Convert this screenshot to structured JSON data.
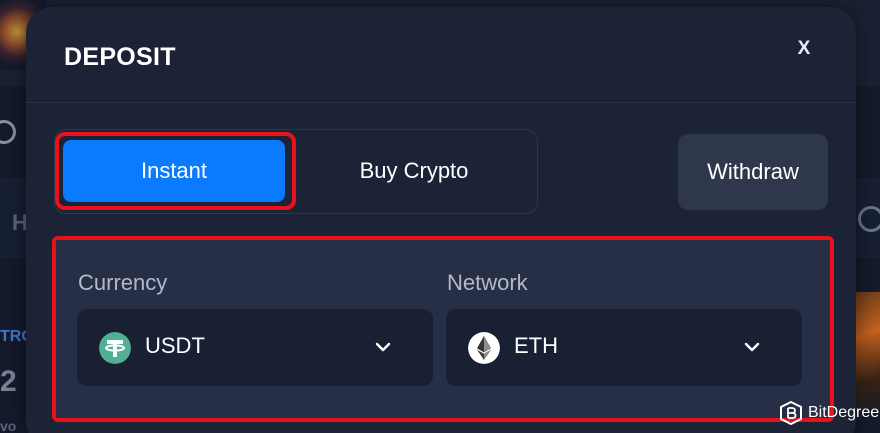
{
  "modal": {
    "title": "DEPOSIT",
    "close_label": "X"
  },
  "tabs": [
    {
      "label": "Instant",
      "active": true
    },
    {
      "label": "Buy Crypto",
      "active": false
    }
  ],
  "withdraw_label": "Withdraw",
  "currency": {
    "label": "Currency",
    "value": "USDT",
    "icon": "tether-icon"
  },
  "network": {
    "label": "Network",
    "value": "ETH",
    "icon": "ethereum-icon"
  },
  "watermark": {
    "text": "BitDegree"
  },
  "colors": {
    "accent": "#0a7bff",
    "highlight": "#e8121b",
    "modal_bg": "#1c2337",
    "tether": "#50af95"
  }
}
